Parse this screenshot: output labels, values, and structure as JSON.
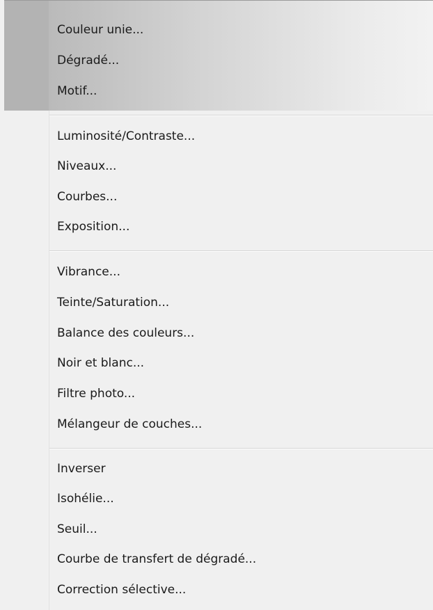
{
  "menu": {
    "groups": [
      {
        "items": [
          {
            "label": "Couleur unie..."
          },
          {
            "label": "Dégradé..."
          },
          {
            "label": "Motif..."
          }
        ]
      },
      {
        "items": [
          {
            "label": "Luminosité/Contraste..."
          },
          {
            "label": "Niveaux..."
          },
          {
            "label": "Courbes..."
          },
          {
            "label": "Exposition..."
          }
        ]
      },
      {
        "items": [
          {
            "label": "Vibrance..."
          },
          {
            "label": "Teinte/Saturation..."
          },
          {
            "label": "Balance des couleurs..."
          },
          {
            "label": "Noir et blanc..."
          },
          {
            "label": "Filtre photo..."
          },
          {
            "label": "Mélangeur de couches..."
          }
        ]
      },
      {
        "items": [
          {
            "label": "Inverser"
          },
          {
            "label": "Isohélie..."
          },
          {
            "label": "Seuil..."
          },
          {
            "label": "Courbe de transfert de dégradé..."
          },
          {
            "label": "Correction sélective..."
          }
        ]
      }
    ]
  }
}
